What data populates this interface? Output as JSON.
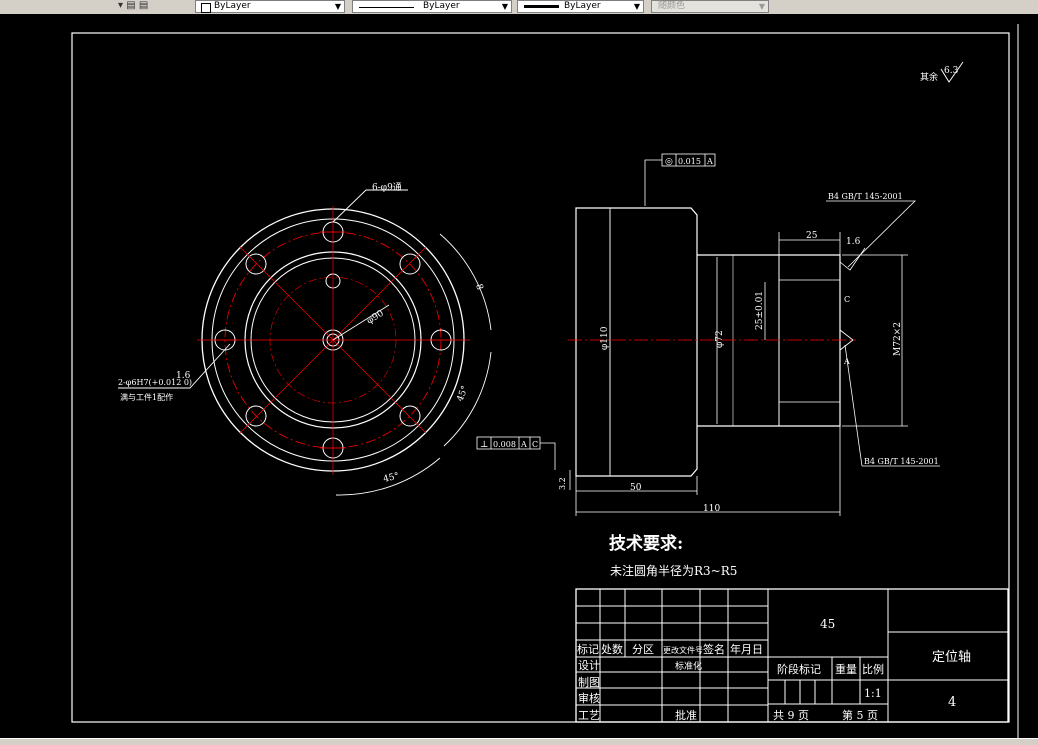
{
  "toolbar": {
    "color_value": "ByLayer",
    "linetype_value": "ByLayer",
    "lineweight_value": "ByLayer",
    "plotstyle_value": "随颜色"
  },
  "drawing": {
    "surface_roughness_default": "其余",
    "surface_roughness_default_value": "6.3",
    "flange": {
      "holes_note": "6-φ9通",
      "diameter_90": "φ90",
      "dimension_8": "8",
      "angle_45_a": "45°",
      "angle_45_b": "45°",
      "pin_holes_note": "2-φ6H7(+0.012 0)",
      "pin_roughness": "1.6",
      "pin_match_note": "满与工件1配作"
    },
    "shaft": {
      "coaxiality_symbol": "◎",
      "coaxiality_value": "0.015",
      "coaxiality_datum": "A",
      "perpendicularity_symbol": "⊥",
      "perpendicularity_value": "0.008",
      "perpendicularity_datum_a": "A",
      "perpendicularity_datum_c": "C",
      "center_hole_top": "B4 GB/T 145-2001",
      "center_hole_bottom": "B4 GB/T 145-2001",
      "dim_25": "25",
      "roughness_1_6": "1.6",
      "dim_110_dia": "φ110",
      "dim_72_dia": "φ72",
      "dim_25_tol": "25±0.01",
      "thread": "M72×2",
      "dim_50": "50",
      "dim_110": "110",
      "roughness_3_2": "3.2",
      "datum_c": "C",
      "datum_a": "A"
    },
    "requirements": {
      "title": "技术要求:",
      "line1": "未注圆角半径为R3~R5"
    },
    "title_block": {
      "material": "45",
      "part_name": "定位轴",
      "drawing_no": "4",
      "header_mark": "标记",
      "header_count": "处数",
      "header_zone": "分区",
      "header_doc": "更改文件号",
      "header_sign": "签名",
      "header_date": "年月日",
      "design": "设计",
      "standardize": "标准化",
      "drawing": "制图",
      "check": "审核",
      "process": "工艺",
      "approve": "批准",
      "stage_mark": "阶段标记",
      "weight": "重量",
      "scale": "比例",
      "scale_value": "1:1",
      "total_sheets": "共 9 页",
      "sheet_no": "第 5 页"
    }
  },
  "colors": {
    "background": "#000000",
    "lines": "#ffffff",
    "centerlines": "#ff0000",
    "toolbar": "#d4d0c8"
  }
}
